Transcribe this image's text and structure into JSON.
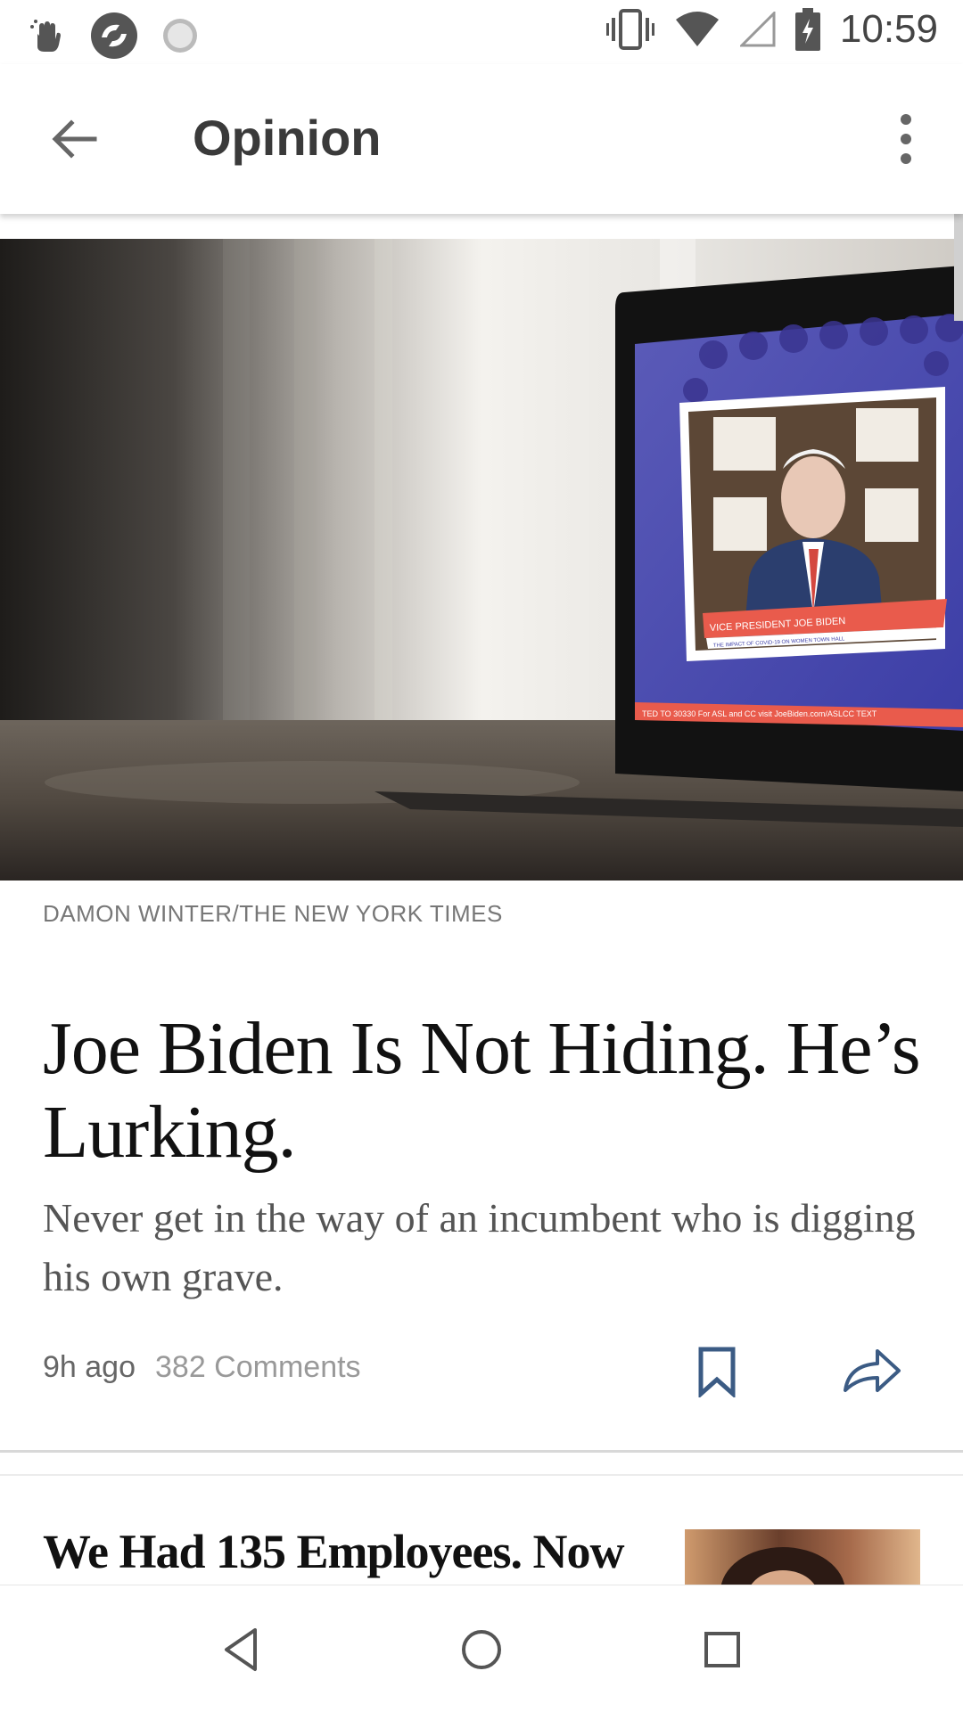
{
  "status_bar": {
    "time": "10:59",
    "left_icons": [
      "hand-icon",
      "app-icon",
      "loading-icon"
    ],
    "right_icons": [
      "vibrate-icon",
      "wifi-icon",
      "signal-icon",
      "battery-charging-icon"
    ]
  },
  "app_bar": {
    "title": "Opinion",
    "back_icon": "arrow-left-icon",
    "menu_icon": "more-vert-icon"
  },
  "article": {
    "image_credit": "DAMON WINTER/THE NEW YORK TIMES",
    "image_overlay": {
      "lower_third": "VICE PRESIDENT JOE BIDEN",
      "lower_third_sub": "THE IMPACT OF COVID-19 ON WOMEN TOWN HALL",
      "ticker": "TED TO 30330   For ASL and CC visit JoeBiden.com/ASLCC   TEXT"
    },
    "headline": "Joe Biden Is Not Hiding. He’s Lurking.",
    "summary": "Never get in the way of an incumbent who is digging his own grave.",
    "time_ago": "9h ago",
    "comments": "382 Comments"
  },
  "next_article": {
    "headline": "We Had 135 Employees. Now"
  },
  "colors": {
    "background": "#ffffff",
    "title_text": "#3a3a3a",
    "headline_text": "#111111",
    "summary_text": "#555555",
    "icon_gray": "#555555",
    "icon_blue": "#3b5b84"
  }
}
